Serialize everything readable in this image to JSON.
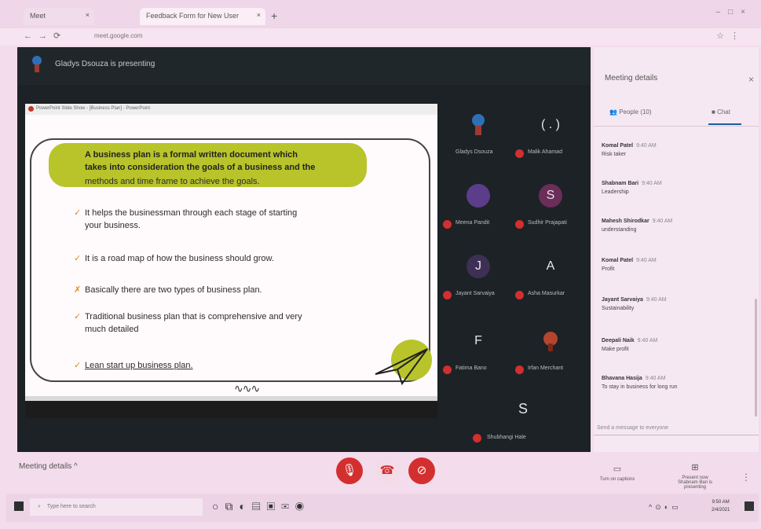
{
  "browser": {
    "tabs": [
      {
        "label": "Meet"
      },
      {
        "label": "Feedback Form for New User"
      }
    ],
    "url": "meet.google.com"
  },
  "meet": {
    "presenter_banner": "Gladys Dsouza is presenting",
    "screen": {
      "toolbar_text": "PowerPoint Slide Show - [Business Plan] - PowerPoint",
      "slide": {
        "lead_line1": "A business plan is a formal written document which",
        "lead_line2": "takes into consideration the goals of a business and the",
        "lead_line3": "methods and time frame to achieve the goals.",
        "bullets": [
          "It helps the businessman through each stage of starting",
          "your business.",
          "It is a road map of how the business should grow.",
          "Basically there are two types of business plan.",
          "Traditional business plan that is comprehensive and very",
          "much detailed",
          "Lean start up business plan."
        ]
      }
    },
    "participants": [
      {
        "name": "Gladys Dsouza",
        "initial": ""
      },
      {
        "name": "Malik Ahamad",
        "initial": "( . )"
      },
      {
        "name": "Meena Pandit",
        "initial": ""
      },
      {
        "name": "Sudhir Prajapati",
        "initial": "S"
      },
      {
        "name": "Jayant Sarvaiya",
        "initial": "J"
      },
      {
        "name": "Asha Masurkar",
        "initial": "A"
      },
      {
        "name": "Fatima Bano",
        "initial": "F"
      },
      {
        "name": "Irfan Merchant",
        "initial": ""
      },
      {
        "name": "Shubhangi Hale",
        "initial": "S"
      }
    ]
  },
  "panel": {
    "title": "Meeting details",
    "tab_people": "People (10)",
    "tab_chat": "Chat",
    "messages": [
      {
        "sender": "Komal Patel",
        "time": "9:40 AM",
        "body": "Risk taker"
      },
      {
        "sender": "Shabnam Bari",
        "time": "9:40 AM",
        "body": "Leadership"
      },
      {
        "sender": "Mahesh Shirodkar",
        "time": "9:40 AM",
        "body": "understanding"
      },
      {
        "sender": "Komal Patel",
        "time": "9:40 AM",
        "body": "Profit"
      },
      {
        "sender": "Jayant Sarvaiya",
        "time": "9:40 AM",
        "body": "Sustainability"
      },
      {
        "sender": "Deepali Naik",
        "time": "9:40 AM",
        "body": "Make profit"
      },
      {
        "sender": "Bhavana Hasija",
        "time": "9:40 AM",
        "body": "To stay in business for long run"
      }
    ],
    "input_placeholder": "Send a message to everyone"
  },
  "controls": {
    "meeting_details": "Meeting details",
    "captions_label": "Turn on captions",
    "present_label": "Shabnam Bari is presenting",
    "present_label_top": "Present now"
  },
  "taskbar": {
    "search_placeholder": "Type here to search",
    "time": "9:50 AM",
    "date": "2/4/2021"
  },
  "colors": {
    "meet_bg": "#1c2226",
    "end_call_red": "#d32f2f",
    "slide_highlight": "#b8c42a",
    "chat_accent": "#1a5c9e"
  }
}
